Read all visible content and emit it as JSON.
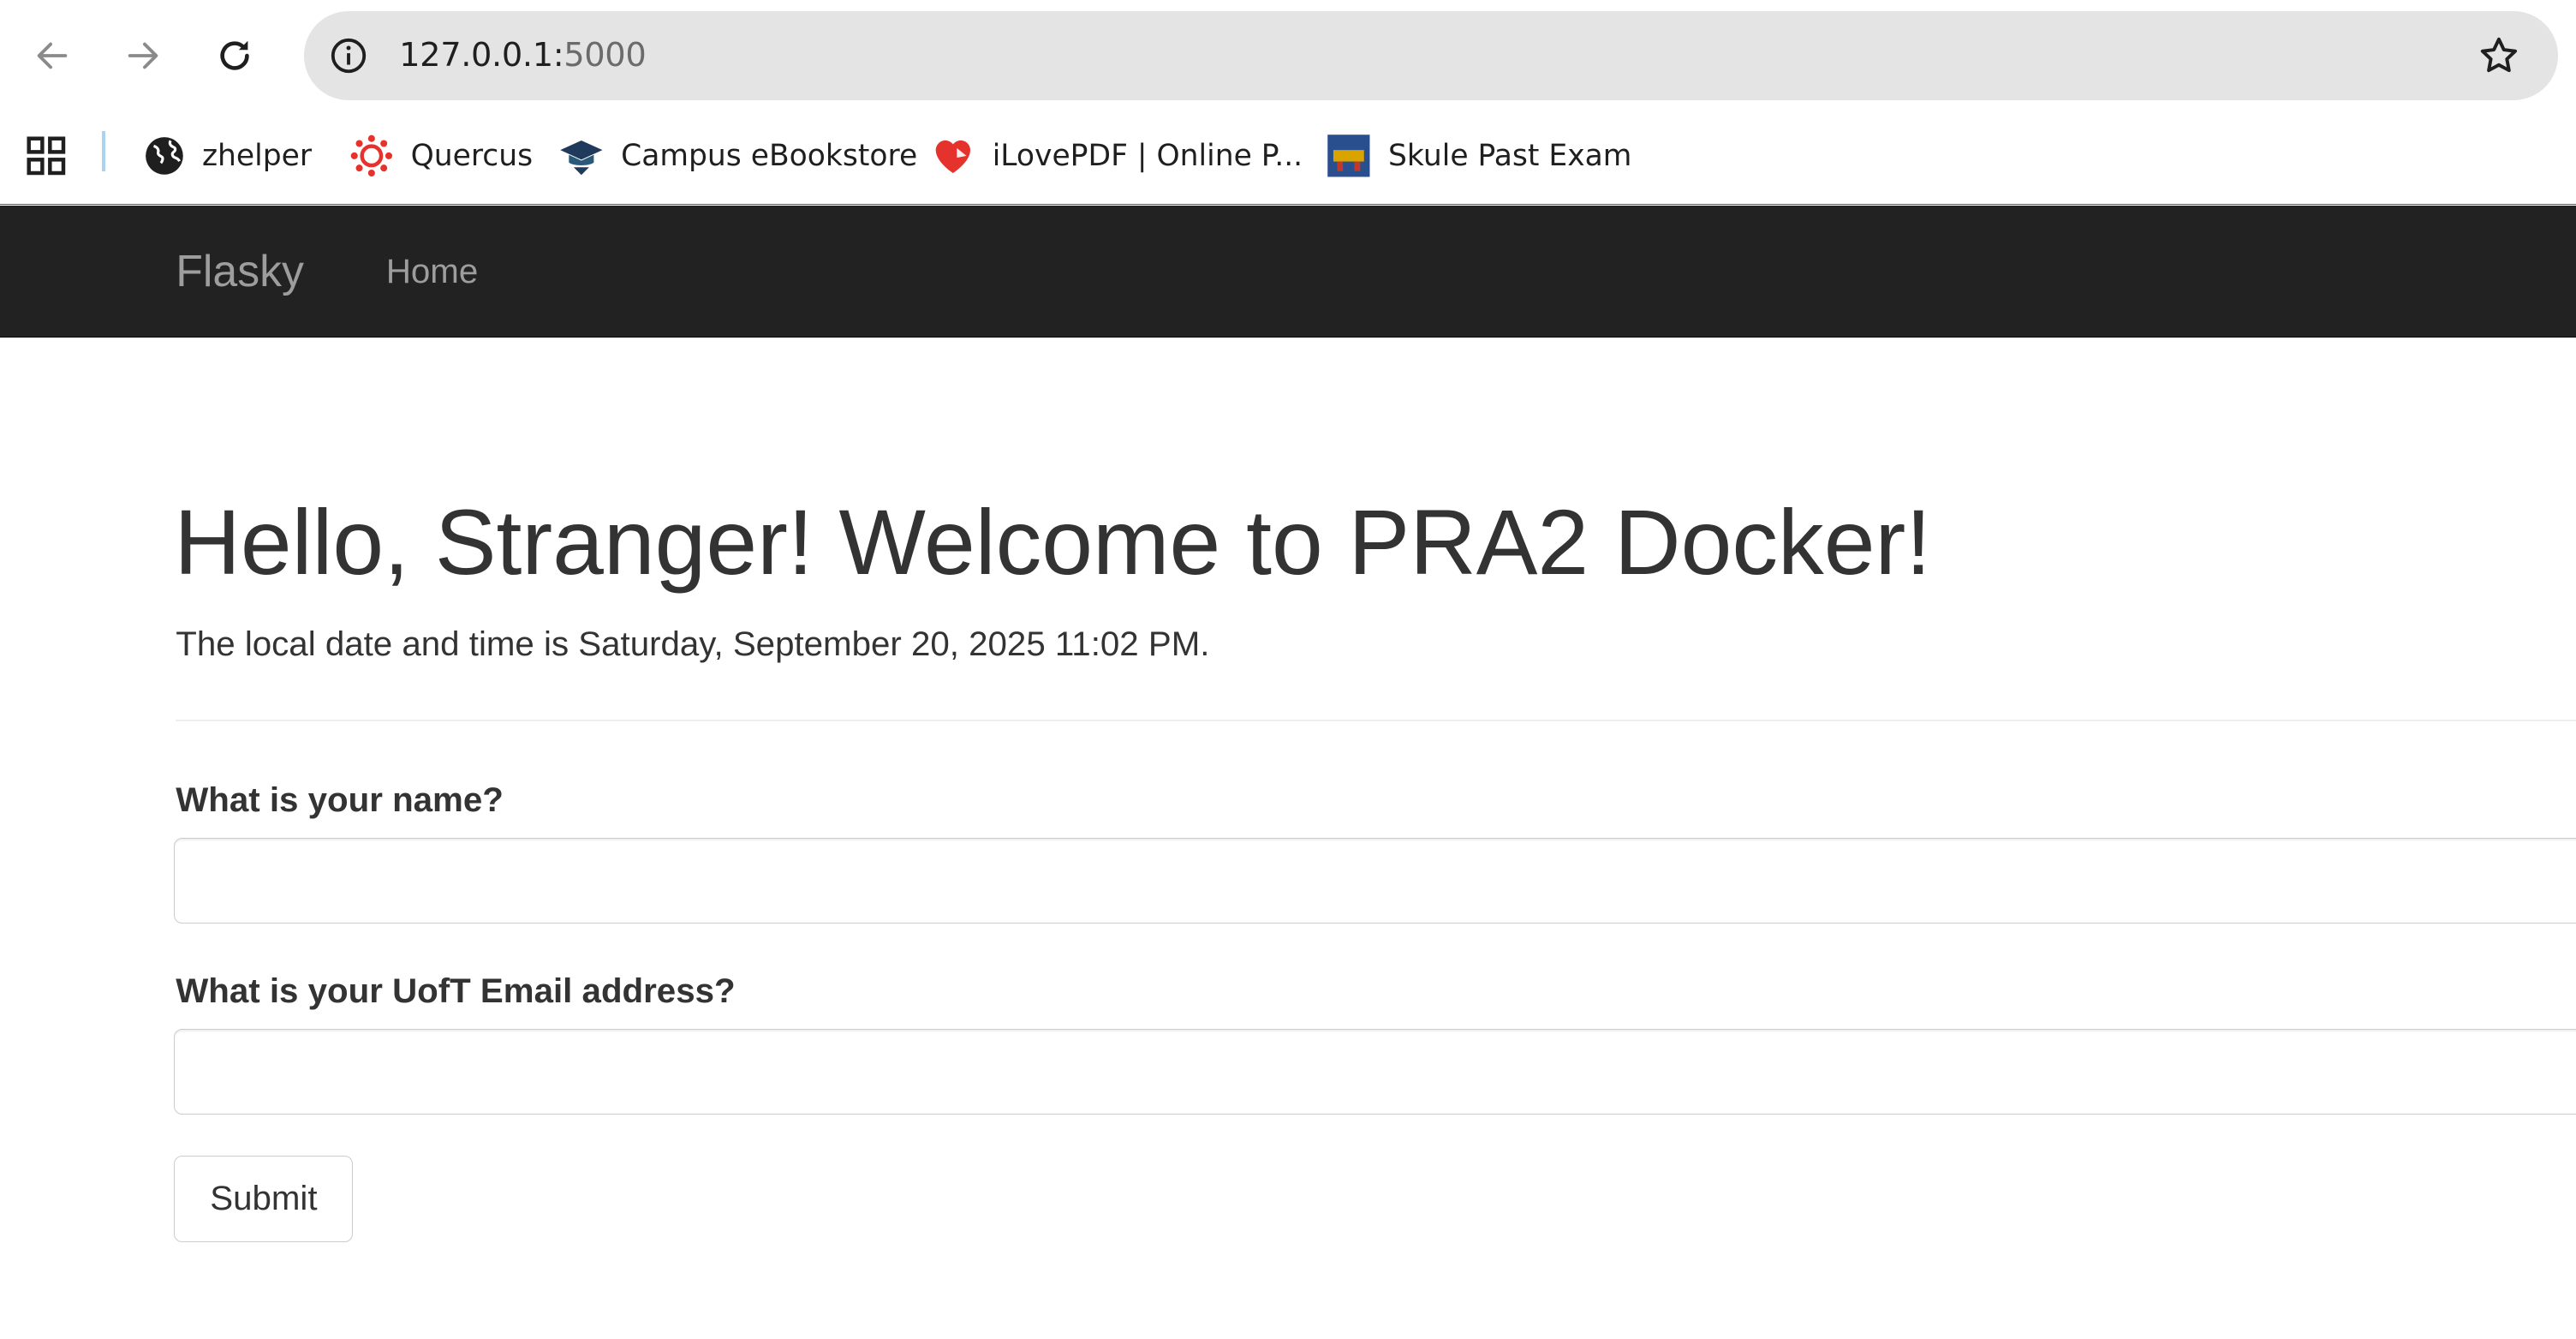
{
  "browser": {
    "url_host": "127.0.0.1:",
    "url_port": "5000",
    "bookmarks": [
      {
        "label": "zhelper",
        "icon": "globe-icon"
      },
      {
        "label": "Quercus",
        "icon": "quercus-logo-icon",
        "color": "#e5322d"
      },
      {
        "label": "Campus eBookstore",
        "icon": "graduation-cap-icon",
        "color": "#1f3a5a"
      },
      {
        "label": "iLovePDF | Online P...",
        "icon": "heart-icon",
        "color": "#e5322d"
      },
      {
        "label": "Skule Past Exam",
        "icon": "skule-logo-icon",
        "color": "#2a4f8f"
      }
    ]
  },
  "navbar": {
    "brand": "Flasky",
    "home": "Home",
    "background": "#222222"
  },
  "main": {
    "title": "Hello, Stranger! Welcome to PRA2 Docker!",
    "local_time": "The local date and time is Saturday, September 20, 2025 11:02 PM.",
    "form": {
      "name_label": "What is your name?",
      "name_value": "",
      "email_label": "What is your UofT Email address?",
      "email_value": "",
      "submit_label": "Submit"
    }
  }
}
